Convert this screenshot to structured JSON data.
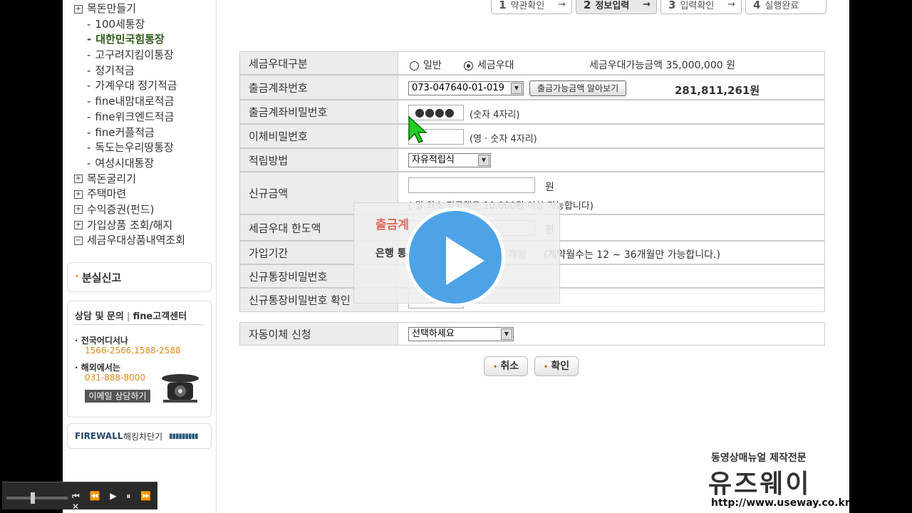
{
  "sidebar": {
    "menu": [
      {
        "label": "목돈만들기",
        "type": "top",
        "marker": "⊞"
      },
      {
        "label": "100세통장",
        "type": "sub"
      },
      {
        "label": "대한민국힘통장",
        "type": "sub",
        "active": true
      },
      {
        "label": "고구려지킴이통장",
        "type": "sub"
      },
      {
        "label": "정기적금",
        "type": "sub"
      },
      {
        "label": "가계우대 정기적금",
        "type": "sub"
      },
      {
        "label": "fine내맘대로적금",
        "type": "sub"
      },
      {
        "label": "fine위크엔드적금",
        "type": "sub"
      },
      {
        "label": "fine커플적금",
        "type": "sub"
      },
      {
        "label": "독도는우리땅통장",
        "type": "sub"
      },
      {
        "label": "여성시대통장",
        "type": "sub"
      },
      {
        "label": "목돈굴리기",
        "type": "top",
        "marker": "⊞"
      },
      {
        "label": "주택마련",
        "type": "top",
        "marker": "⊞"
      },
      {
        "label": "수익증권(펀드)",
        "type": "top",
        "marker": "⊞"
      },
      {
        "label": "가입상품 조회/해지",
        "type": "top",
        "marker": "⊞"
      },
      {
        "label": "세금우대상품내역조회",
        "type": "top",
        "marker": "⊟"
      }
    ],
    "lost_report": "분실신고",
    "cs": {
      "title_a": "상담 및 문의",
      "title_b": "fine고객센터",
      "domestic_label": "· 전국어디서나",
      "domestic_phone": "1566-2566,1588-2588",
      "overseas_label": "· 해외에서는",
      "overseas_phone": "031-888-8000",
      "email_button": "이메일 상담하기"
    },
    "firewall": {
      "brand": "FIREWALL",
      "label": "해킹차단기",
      "bars": "▮▮▮▮▮▮▮▮▮"
    }
  },
  "player": {
    "controls": "⏮ ⏪ ▶ ⏸ ⏩ ✕"
  },
  "steps": [
    {
      "num": "1",
      "label": "약관확인",
      "arrow": "→"
    },
    {
      "num": "2",
      "label": "정보입력",
      "arrow": "→",
      "active": true
    },
    {
      "num": "3",
      "label": "입력확인",
      "arrow": "→"
    },
    {
      "num": "4",
      "label": "실행완료"
    }
  ],
  "form": {
    "tax_type": {
      "label": "세금우대구분",
      "opt_general": "일반",
      "opt_tax": "세금우대",
      "limit_text": "세금우대가능금액 35,000,000 원",
      "selected": "세금우대"
    },
    "account": {
      "label": "출금계좌번호",
      "value": "073-047640-01-019",
      "check_button": "출금가능금액 알아보기",
      "balance": "281,811,261원"
    },
    "account_pw": {
      "label": "출금계좌비밀번호",
      "masked": "●●●●",
      "hint": "(숫자 4자리)"
    },
    "transfer_pw": {
      "label": "이체비밀번호",
      "hint": "(영 · 숫자 4자리)"
    },
    "method": {
      "label": "적립방법",
      "value": "자유적립식"
    },
    "new_amount": {
      "label": "신규금액",
      "unit": "원",
      "note": "( 월 최소 적금액은 10,000원 이상 가능합니다)"
    },
    "tax_limit": {
      "label": "세금우대 한도액",
      "unit": "원"
    },
    "period": {
      "label": "가입기간",
      "unit": "개월",
      "note": "(계약월수는 12 ~ 36개월만 가능합니다.)"
    },
    "new_pw": {
      "label": "신규통장비밀번호"
    },
    "new_pw_confirm": {
      "label": "신규통장비밀번호 확인"
    },
    "auto_transfer": {
      "label": "자동이체 신청",
      "value": "선택하세요"
    }
  },
  "actions": {
    "cancel": "취소",
    "confirm": "확인"
  },
  "popup": {
    "title": "출금계",
    "line": "은행 통"
  },
  "watermark": {
    "line1": "동영상매뉴얼 제작전문",
    "brand": "유즈웨이",
    "url": "http://www.useway.co.kr"
  },
  "colors": {
    "active_menu": "#2d5a1b",
    "accent_orange": "#e08a1e",
    "play_button": "#4ea3e6",
    "cursor": "#22cc22"
  }
}
